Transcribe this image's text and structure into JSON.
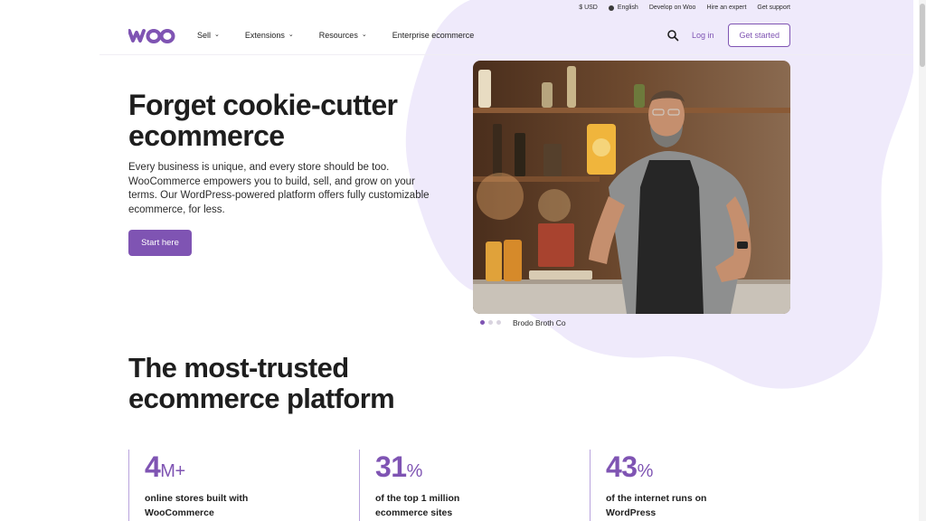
{
  "utility": {
    "currency": "$ USD",
    "language": "English",
    "develop": "Develop on Woo",
    "hire": "Hire an expert",
    "support": "Get support"
  },
  "nav": {
    "logo": "woo",
    "items": [
      {
        "label": "Sell",
        "has_dropdown": true
      },
      {
        "label": "Extensions",
        "has_dropdown": true
      },
      {
        "label": "Resources",
        "has_dropdown": true
      },
      {
        "label": "Enterprise ecommerce",
        "has_dropdown": false
      }
    ],
    "login": "Log in",
    "get_started": "Get started"
  },
  "hero": {
    "title": "Forget cookie-cutter ecommerce",
    "description": "Every business is unique, and every store should be too. WooCommerce empowers you to build, sell, and grow on your terms. Our WordPress-powered platform offers fully customizable ecommerce, for less.",
    "cta": "Start here",
    "caption": "Brodo Broth Co",
    "carousel_active_index": 0,
    "carousel_count": 3
  },
  "trusted": {
    "title": "The most-trusted ecommerce platform"
  },
  "stats": [
    {
      "value": "4",
      "unit": "M+",
      "desc": "online stores built with WooCommerce"
    },
    {
      "value": "31",
      "unit": "%",
      "desc": "of the top 1 million ecommerce sites"
    },
    {
      "value": "43",
      "unit": "%",
      "desc": "of the internet runs on WordPress"
    }
  ],
  "colors": {
    "brand": "#7f54b3",
    "blob": "#efeafb",
    "text": "#1e1e1e"
  },
  "icons": [
    "globe-icon",
    "search-icon",
    "chevron-down-icon",
    "woo-logo"
  ]
}
